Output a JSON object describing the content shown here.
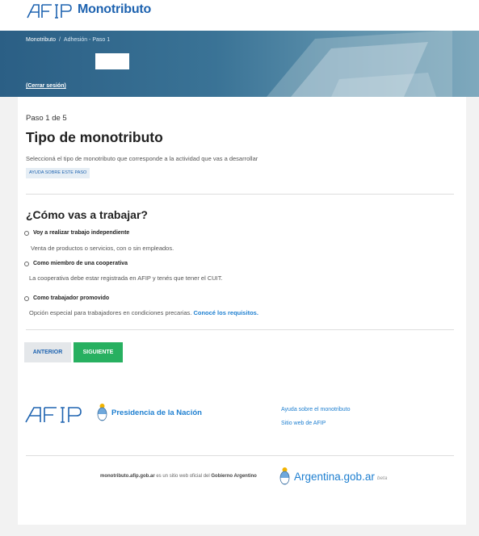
{
  "header": {
    "app_name": "Monotributo",
    "logo_text": "AFIP"
  },
  "banner": {
    "breadcrumb": [
      "Monotributo",
      "Adhesión - Paso 1"
    ],
    "logout": "(Cerrar sesión)"
  },
  "form": {
    "step": "Paso 1 de 5",
    "title": "Tipo de monotributo",
    "subtitle": "Seleccioná el tipo de monotributo que corresponde a la actividad que vas a desarrollar",
    "help_chip": "AYUDA SOBRE ESTE PASO",
    "question": "¿Cómo vas a trabajar?",
    "options": [
      {
        "label": "Voy a realizar trabajo independiente",
        "desc": "Venta de productos o servicios, con o sin empleados."
      },
      {
        "label": "Como miembro de una cooperativa",
        "desc": "La cooperativa debe estar registrada en AFIP y tenés que tener el CUIT."
      },
      {
        "label": "Como trabajador promovido",
        "desc": "Opción especial para trabajadores en condiciones precarias.",
        "link": "Conocé los requisitos."
      }
    ],
    "buttons": {
      "prev": "ANTERIOR",
      "next": "SIGUIENTE"
    }
  },
  "footer": {
    "presidencia": "Presidencia de la Nación",
    "links": [
      "Ayuda sobre el monotributo",
      "Sitio web de AFIP"
    ],
    "official_domain": "monotributo.afip.gob.ar",
    "official_mid": "es un sitio web oficial del",
    "official_gov": "Gobierno Argentino",
    "argentina": "Argentina.gob.ar",
    "beta": "beta"
  },
  "colors": {
    "accent": "#1e63b0",
    "link": "#1e7fd0",
    "next_button": "#27b060",
    "banner": "#2b5f85"
  }
}
